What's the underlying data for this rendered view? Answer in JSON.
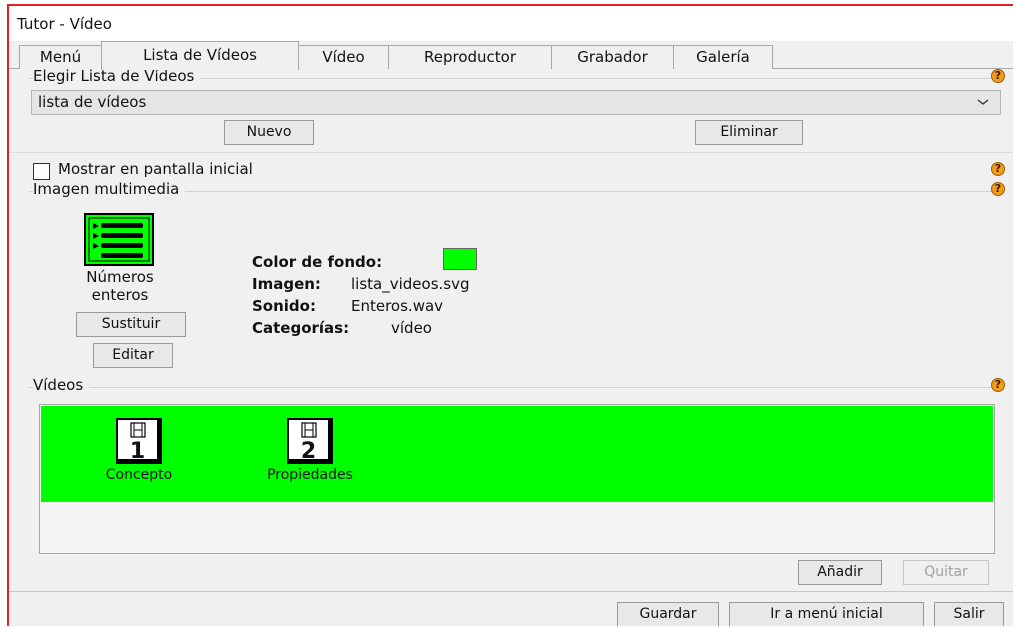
{
  "window": {
    "title": "Tutor - Vídeo"
  },
  "tabs": [
    {
      "label": "Menú"
    },
    {
      "label": "Lista de Vídeos",
      "active": true
    },
    {
      "label": "Vídeo"
    },
    {
      "label": "Reproductor"
    },
    {
      "label": "Grabador"
    },
    {
      "label": "Galería"
    }
  ],
  "list_section": {
    "legend": "Elegir Lista de Vídeos",
    "selected": "lista de vídeos",
    "new_label": "Nuevo",
    "delete_label": "Eliminar"
  },
  "show_initial": {
    "label": "Mostrar en pantalla inicial",
    "checked": false
  },
  "media_section": {
    "legend": "Imagen multimedia",
    "icon_caption_1": "Números",
    "icon_caption_2": "enteros",
    "replace_label": "Sustituir",
    "edit_label": "Editar",
    "bg_color_label": "Color de fondo:",
    "bg_color": "#00ff00",
    "image_label": "Imagen:",
    "image_value": "lista_videos.svg",
    "sound_label": "Sonido:",
    "sound_value": "Enteros.wav",
    "categories_label": "Categorías:",
    "categories_value": "vídeo"
  },
  "videos_section": {
    "legend": "Vídeos",
    "items": [
      {
        "number": "1",
        "name": "Concepto"
      },
      {
        "number": "2",
        "name": "Propiedades"
      }
    ],
    "add_label": "Añadir",
    "remove_label": "Quitar"
  },
  "footer": {
    "save_label": "Guardar",
    "home_label": "Ir a menú inicial",
    "exit_label": "Salir"
  },
  "icons": {
    "help": "help-icon",
    "list": "video-list-icon",
    "video": "film-icon",
    "dropdown": "chevron-down-icon"
  }
}
